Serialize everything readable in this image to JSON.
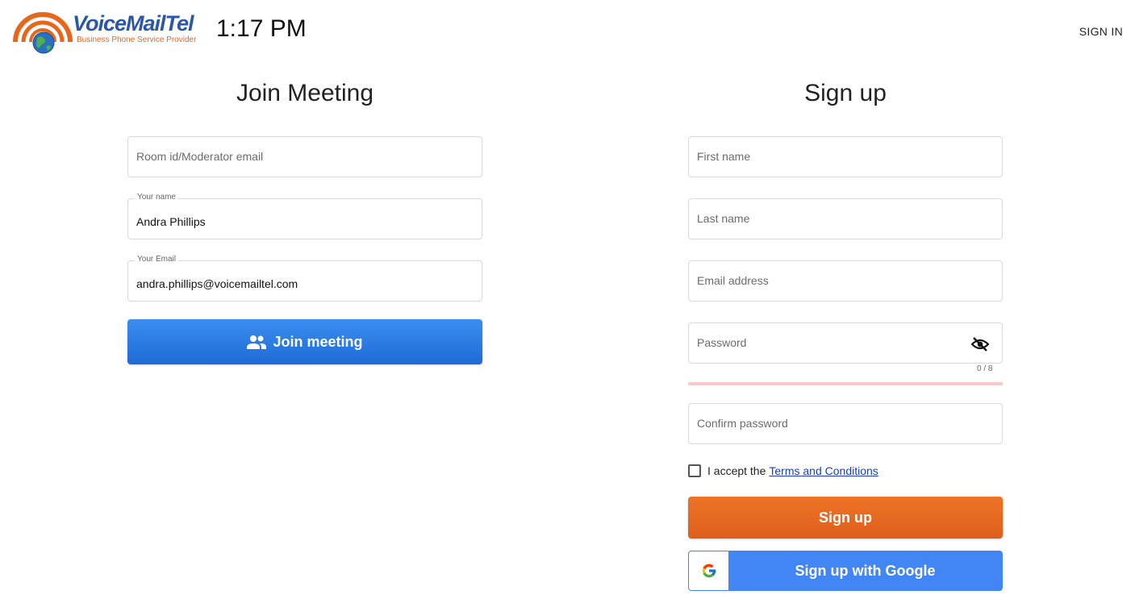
{
  "brand": {
    "name_part1": "VoiceMail",
    "name_part2": "Tel",
    "tagline": "Business Phone Service Provider",
    "primary_color": "#2a57a8",
    "accent_color": "#e8661c"
  },
  "header": {
    "clock": "1:17 PM",
    "signin_label": "SIGN IN"
  },
  "join": {
    "title": "Join Meeting",
    "room_placeholder": "Room id/Moderator email",
    "name_label": "Your name",
    "name_value": "Andra Phillips",
    "email_label": "Your Email",
    "email_value": "andra.phillips@voicemailtel.com",
    "button_label": "Join meeting",
    "button_icon": "people-icon",
    "button_color": "#2a7de8"
  },
  "signup": {
    "title": "Sign up",
    "first_name_placeholder": "First name",
    "last_name_placeholder": "Last name",
    "email_placeholder": "Email address",
    "password_placeholder": "Password",
    "password_icon": "visibility-off-icon",
    "password_counter": "0 / 8",
    "confirm_placeholder": "Confirm password",
    "terms_prefix": "I accept the",
    "terms_link": "Terms and Conditions",
    "submit_label": "Sign up",
    "submit_color": "#e8681f",
    "google_label": "Sign up with Google",
    "google_color": "#4285f4"
  }
}
